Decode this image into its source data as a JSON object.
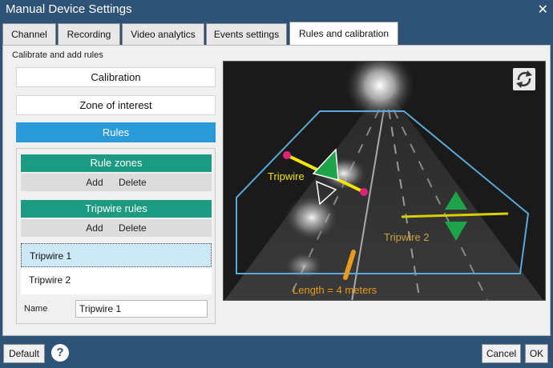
{
  "window": {
    "title": "Manual Device Settings",
    "close_glyph": "✕"
  },
  "tabs": [
    {
      "label": "Channel"
    },
    {
      "label": "Recording"
    },
    {
      "label": "Video analytics"
    },
    {
      "label": "Events settings"
    },
    {
      "label": "Rules and calibration"
    }
  ],
  "active_tab": "Rules and calibration",
  "section": {
    "title": "Calibrate and add rules"
  },
  "sidebar": {
    "calibration": "Calibration",
    "zone_of_interest": "Zone of interest",
    "rules": "Rules"
  },
  "rule_zones": {
    "header": "Rule zones",
    "add": "Add",
    "delete": "Delete"
  },
  "tripwire_rules": {
    "header": "Tripwire rules",
    "add": "Add",
    "delete": "Delete",
    "items": [
      {
        "label": "Tripwire 1"
      },
      {
        "label": "Tripwire 2"
      }
    ],
    "selected": "Tripwire 1"
  },
  "name_field": {
    "label": "Name",
    "value": "Tripwire 1"
  },
  "video": {
    "tripwire1_label": "Tripwire",
    "tripwire2_label": "Tripwire 2",
    "length_label": "Length = 4 meters",
    "rotate_icon": "rotate-icon"
  },
  "footer": {
    "default_label": "Default",
    "help_glyph": "?",
    "cancel_label": "Cancel",
    "ok_label": "OK"
  },
  "colors": {
    "titlebar": "#2f5377",
    "rules_active": "#2a9ad8",
    "group_header": "#1c9a82",
    "zone_outline": "#5aa9d6",
    "tripwire1": "#f2e600",
    "tripwire2": "#d6d000",
    "arrow_green": "#1fa34a",
    "handle_pink": "#e0237a",
    "length_orange": "#e89a1c"
  }
}
